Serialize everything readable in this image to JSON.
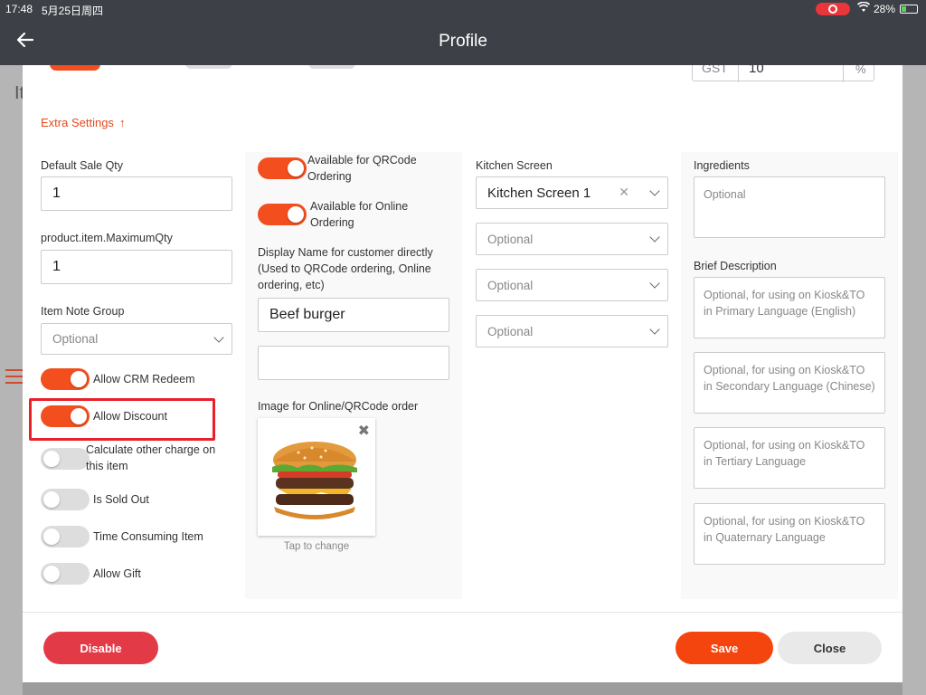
{
  "status_bar": {
    "time": "17:48",
    "date": "5月25日周四",
    "battery": "28%"
  },
  "header": {
    "title": "Profile"
  },
  "background": {
    "partial_text": "It"
  },
  "top_strip": {
    "gst_label": "GST",
    "gst_value": "10",
    "gst_unit": "%"
  },
  "extra_settings": {
    "label": "Extra Settings",
    "arrow": "↑"
  },
  "col1": {
    "default_sale_qty_label": "Default Sale Qty",
    "default_sale_qty_value": "1",
    "maximum_qty_label": "product.item.MaximumQty",
    "maximum_qty_value": "1",
    "item_note_group_label": "Item Note Group",
    "item_note_group_placeholder": "Optional",
    "toggles": [
      {
        "label": "Allow CRM Redeem",
        "on": true
      },
      {
        "label": "Allow Discount",
        "on": true
      },
      {
        "label": "Calculate other charge on this item",
        "on": false
      },
      {
        "label": "Is Sold Out",
        "on": false
      },
      {
        "label": "Time Consuming Item",
        "on": false
      },
      {
        "label": "Allow Gift",
        "on": false
      }
    ]
  },
  "col2": {
    "toggles": [
      {
        "label": "Available for QRCode Ordering",
        "on": true
      },
      {
        "label": "Available for Online Ordering",
        "on": true
      }
    ],
    "display_name_label": "Display Name for customer directly (Used to QRCode ordering, Online ordering, etc)",
    "display_name_value": "Beef burger",
    "display_name_secondary_value": "",
    "image_label": "Image for Online/QRCode order",
    "tap_to_change": "Tap to change"
  },
  "col3": {
    "kitchen_screen_label": "Kitchen Screen",
    "kitchen_screens": [
      "Kitchen Screen 1",
      "Optional",
      "Optional",
      "Optional"
    ]
  },
  "col4": {
    "ingredients_label": "Ingredients",
    "ingredients_placeholder": "Optional",
    "brief_description_label": "Brief Description",
    "descriptions": [
      "Optional, for using on Kiosk&TO in Primary Language (English)",
      "Optional, for using on Kiosk&TO in Secondary Language (Chinese)",
      "Optional, for using on Kiosk&TO in Tertiary Language",
      "Optional, for using on Kiosk&TO in Quaternary Language"
    ]
  },
  "footer": {
    "disable_label": "Disable",
    "save_label": "Save",
    "close_label": "Close"
  },
  "colors": {
    "accent": "#f24e1e",
    "disable": "#e33a47",
    "highlight": "#e8202a",
    "header": "#3d4046"
  },
  "icons": [
    "back-arrow-icon",
    "wifi-icon",
    "battery-icon",
    "record-icon",
    "chevron-down-icon",
    "clear-icon",
    "close-icon",
    "menu-icon"
  ]
}
